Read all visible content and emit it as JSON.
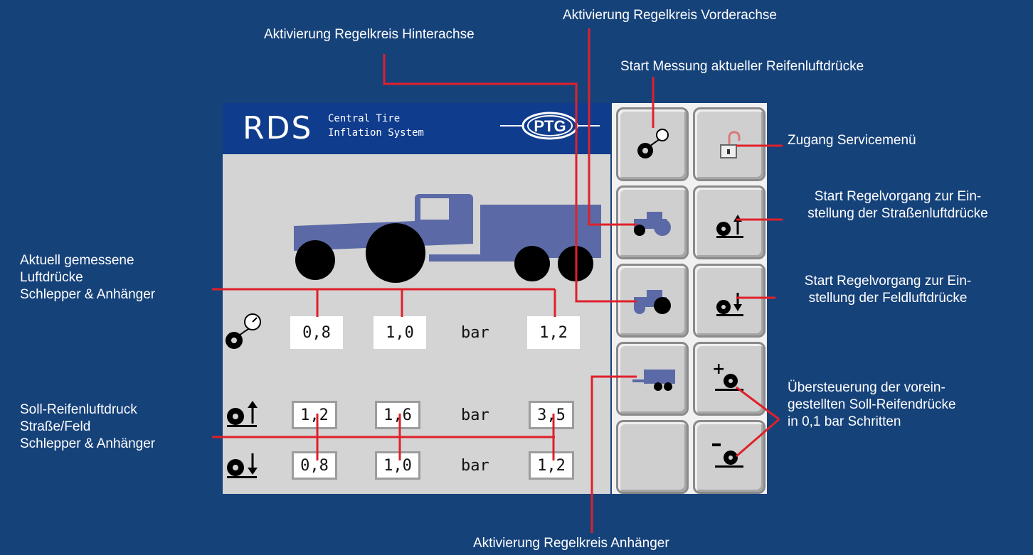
{
  "screen": {
    "brand": "RDS",
    "subtitle_line1": "Central Tire",
    "subtitle_line2": "Inflation System",
    "logo_text": "PTG"
  },
  "readings": {
    "current": [
      "0,8",
      "1,0",
      "1,2"
    ],
    "road": [
      "1,2",
      "1,6",
      "3,5"
    ],
    "field": [
      "0,8",
      "1,0",
      "1,2"
    ],
    "unit": "bar"
  },
  "callouts": {
    "front_axle": "Aktivierung Regelkreis Vorderachse",
    "rear_axle": "Aktivierung Regelkreis Hinterachse",
    "measure": "Start Messung aktueller Reifenluftdrücke",
    "service": "Zugang Servicemenü",
    "road_line1": "Start Regelvorgang zur Ein-",
    "road_line2": "stellung der Straßenluftdrücke",
    "field_line1": "Start Regelvorgang zur Ein-",
    "field_line2": "stellung der Feldluftdrücke",
    "override_line1": "Übersteuerung der vorein-",
    "override_line2": "gestellten Soll-Reifendrücke",
    "override_line3": "in 0,1 bar Schritten",
    "trailer": "Aktivierung Regelkreis Anhänger",
    "current_line1": "Aktuell gemessene",
    "current_line2": "Luftdrücke",
    "current_line3": "Schlepper & Anhänger",
    "target_line1": "Soll-Reifenluftdruck",
    "target_line2": "Straße/Feld",
    "target_line3": "Schlepper & Anhänger"
  },
  "icons": {
    "measure_button": "tire-gauge-icon",
    "service_button": "padlock-open-icon",
    "front_axle_button": "tractor-front-icon",
    "road_button": "tire-up-icon",
    "rear_axle_button": "tractor-rear-icon",
    "field_button": "tire-down-icon",
    "trailer_button": "trailer-icon",
    "plus_button": "tire-plus-icon",
    "minus_button": "tire-minus-icon"
  },
  "colors": {
    "background": "#16427a",
    "header": "#0f3c8c",
    "leader_line": "#e0202a",
    "vehicle": "#5b6aa6"
  }
}
